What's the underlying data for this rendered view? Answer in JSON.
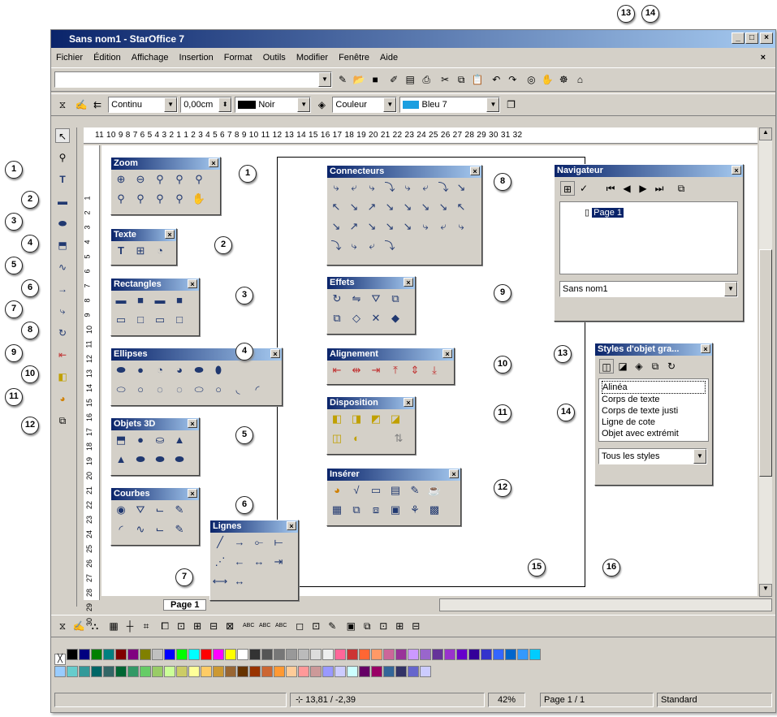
{
  "window": {
    "title": "Sans nom1 - StarOffice 7",
    "close_doc": "×"
  },
  "menu": [
    "Fichier",
    "Édition",
    "Affichage",
    "Insertion",
    "Format",
    "Outils",
    "Modifier",
    "Fenêtre",
    "Aide"
  ],
  "line": {
    "style": "Continu",
    "width": "0,00cm",
    "color": "Noir",
    "area_mode": "Couleur",
    "area_color": "Bleu 7"
  },
  "ruler_h": "11 10 9 8 7 6 5 4 3 2 1   1 2 3 4 5 6 7 8 9 10 11 12 13 14 15 16 17 18 19 20 21 22 23 24 25 26 27 28 29 30 31 32",
  "ruler_v": [
    "1",
    "2",
    "3",
    "4",
    "5",
    "6",
    "7",
    "8",
    "9",
    "10",
    "11",
    "12",
    "13",
    "14",
    "15",
    "16",
    "17",
    "18",
    "19",
    "20",
    "21",
    "22",
    "23",
    "24",
    "25",
    "26",
    "27",
    "28",
    "29",
    "30"
  ],
  "palettes": {
    "zoom": "Zoom",
    "texte": "Texte",
    "rectangles": "Rectangles",
    "ellipses": "Ellipses",
    "objets3d": "Objets 3D",
    "courbes": "Courbes",
    "lignes": "Lignes",
    "connecteurs": "Connecteurs",
    "effets": "Effets",
    "alignement": "Alignement",
    "disposition": "Disposition",
    "inserer": "Insérer"
  },
  "navigator": {
    "title": "Navigateur",
    "item": "Page 1",
    "doc": "Sans nom1"
  },
  "styles": {
    "title": "Styles d'objet gra...",
    "items": [
      "Alinéa",
      "Corps de texte",
      "Corps de texte justi",
      "Ligne de cote",
      "Objet avec extrémit"
    ],
    "filter": "Tous les styles"
  },
  "tabs": {
    "page": "Page 1"
  },
  "status": {
    "coords": "13,81 / -2,39",
    "zoom": "42%",
    "page": "Page 1 / 1",
    "style": "Standard"
  },
  "callouts": [
    "1",
    "2",
    "3",
    "4",
    "5",
    "6",
    "7",
    "8",
    "9",
    "10",
    "11",
    "12",
    "13",
    "14",
    "15",
    "16"
  ],
  "colors_row1": [
    "#000000",
    "#000080",
    "#008000",
    "#008080",
    "#800000",
    "#800080",
    "#808000",
    "#c0c0c0",
    "#0000ff",
    "#00ff00",
    "#00ffff",
    "#ff0000",
    "#ff00ff",
    "#ffff00",
    "#ffffff",
    "#333333",
    "#555555",
    "#777777",
    "#999999",
    "#bbbbbb",
    "#dddddd",
    "#eeeeee",
    "#ff6699",
    "#cc3333",
    "#ff6633",
    "#ff9966",
    "#cc6699",
    "#993399",
    "#cc99ff",
    "#9966cc",
    "#663399",
    "#9933cc",
    "#6600cc",
    "#330099",
    "#3333cc",
    "#3366ff",
    "#0066cc",
    "#3399ff",
    "#00ccff"
  ],
  "colors_row2": [
    "#99ccff",
    "#66cccc",
    "#339999",
    "#006666",
    "#336666",
    "#006633",
    "#339966",
    "#66cc66",
    "#99cc66",
    "#ccff99",
    "#cccc66",
    "#ffff99",
    "#ffcc66",
    "#cc9933",
    "#996633",
    "#663300",
    "#993300",
    "#cc6633",
    "#ff9933",
    "#ffcc99",
    "#ff9999",
    "#cc9999",
    "#9999ff",
    "#ccccff",
    "#ccffff",
    "#660066",
    "#990066",
    "#336699",
    "#333366",
    "#6666cc",
    "#ccccff"
  ]
}
